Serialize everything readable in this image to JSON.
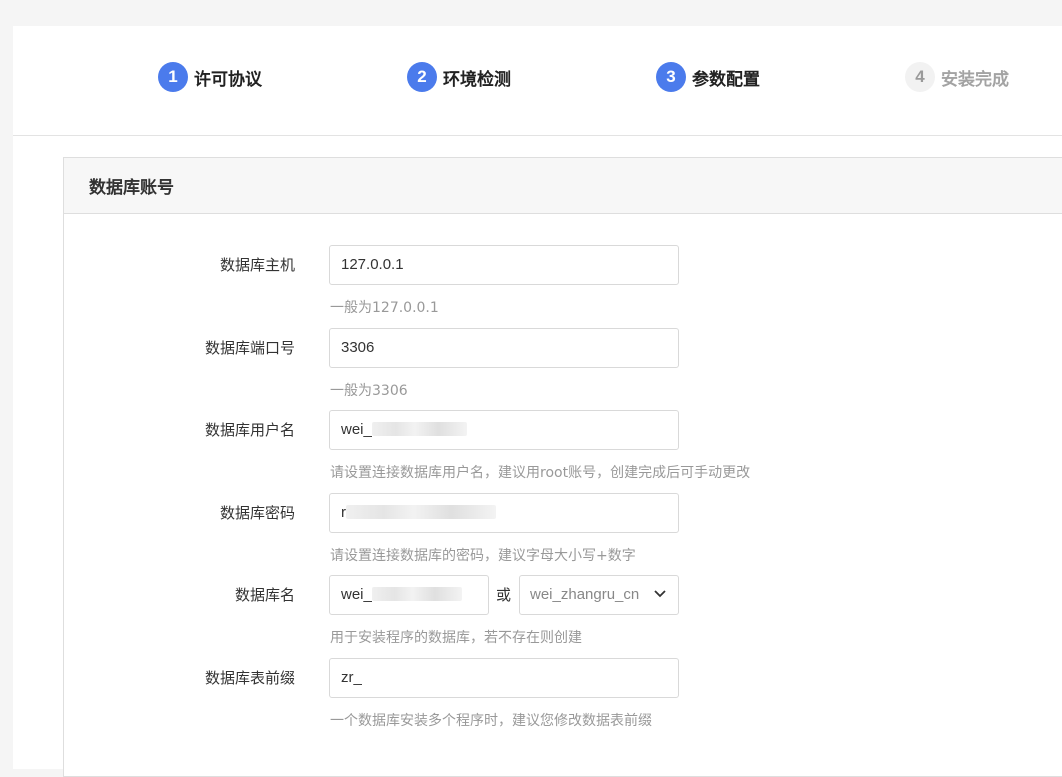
{
  "steps": [
    {
      "num": "1",
      "label": "许可协议",
      "state": "done"
    },
    {
      "num": "2",
      "label": "环境检测",
      "state": "done"
    },
    {
      "num": "3",
      "label": "参数配置",
      "state": "active"
    },
    {
      "num": "4",
      "label": "安装完成",
      "state": "pending"
    }
  ],
  "panel": {
    "title": "数据库账号"
  },
  "form": {
    "host": {
      "label": "数据库主机",
      "value": "127.0.0.1",
      "hint": "一般为127.0.0.1"
    },
    "port": {
      "label": "数据库端口号",
      "value": "3306",
      "hint": "一般为3306"
    },
    "user": {
      "label": "数据库用户名",
      "value": "wei_",
      "hint": "请设置连接数据库用户名，建议用root账号，创建完成后可手动更改"
    },
    "password": {
      "label": "数据库密码",
      "value": "r",
      "hint": "请设置连接数据库的密码，建议字母大小写+数字"
    },
    "dbname": {
      "label": "数据库名",
      "value": "wei_",
      "or": "或",
      "select_value": "wei_zhangru_cn",
      "hint": "用于安装程序的数据库，若不存在则创建"
    },
    "prefix": {
      "label": "数据库表前缀",
      "value": "zr_",
      "hint": "一个数据库安装多个程序时，建议您修改数据表前缀"
    }
  },
  "colors": {
    "accent": "#4b7bec",
    "hint": "#999999"
  }
}
